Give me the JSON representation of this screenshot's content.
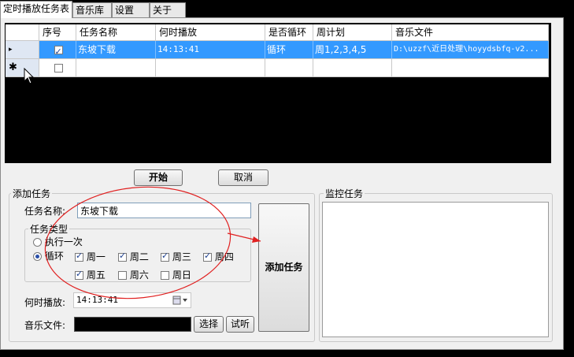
{
  "tabs": [
    {
      "label": "定时播放任务表",
      "active": true
    },
    {
      "label": "音乐库",
      "active": false
    },
    {
      "label": "设置",
      "active": false
    },
    {
      "label": "关于",
      "active": false
    }
  ],
  "grid": {
    "columns": [
      "序号",
      "任务名称",
      "何时播放",
      "是否循环",
      "周计划",
      "音乐文件"
    ],
    "rows": [
      {
        "indicator": "▸",
        "checked": true,
        "name": "东坡下载",
        "time": "14:13:41",
        "loop": "循环",
        "weekly": "周1,2,3,4,5",
        "file": "D:\\uzzf\\近日处理\\hoyydsbfq-v2..."
      },
      {
        "indicator": "✱",
        "checked": false,
        "name": "",
        "time": "",
        "loop": "",
        "weekly": "",
        "file": ""
      }
    ]
  },
  "buttons": {
    "start": "开始",
    "cancel": "取消",
    "add_task": "添加任务",
    "choose": "选择",
    "audition": "试听"
  },
  "add_task": {
    "group_title": "添加任务",
    "name_label": "任务名称:",
    "name_value": "东坡下载",
    "type_group_title": "任务类型",
    "radio_once": "执行一次",
    "radio_loop": "循环",
    "days": [
      {
        "label": "周一",
        "checked": true
      },
      {
        "label": "周二",
        "checked": true
      },
      {
        "label": "周三",
        "checked": true
      },
      {
        "label": "周四",
        "checked": true
      },
      {
        "label": "周五",
        "checked": true
      },
      {
        "label": "周六",
        "checked": false
      },
      {
        "label": "周日",
        "checked": false
      }
    ],
    "time_label": "何时播放:",
    "time_value": "14:13:41",
    "file_label": "音乐文件:"
  },
  "monitor": {
    "group_title": "监控任务"
  },
  "colors": {
    "selection": "#3399ff",
    "annotation": "#e02020",
    "grid_bg": "#000000"
  }
}
